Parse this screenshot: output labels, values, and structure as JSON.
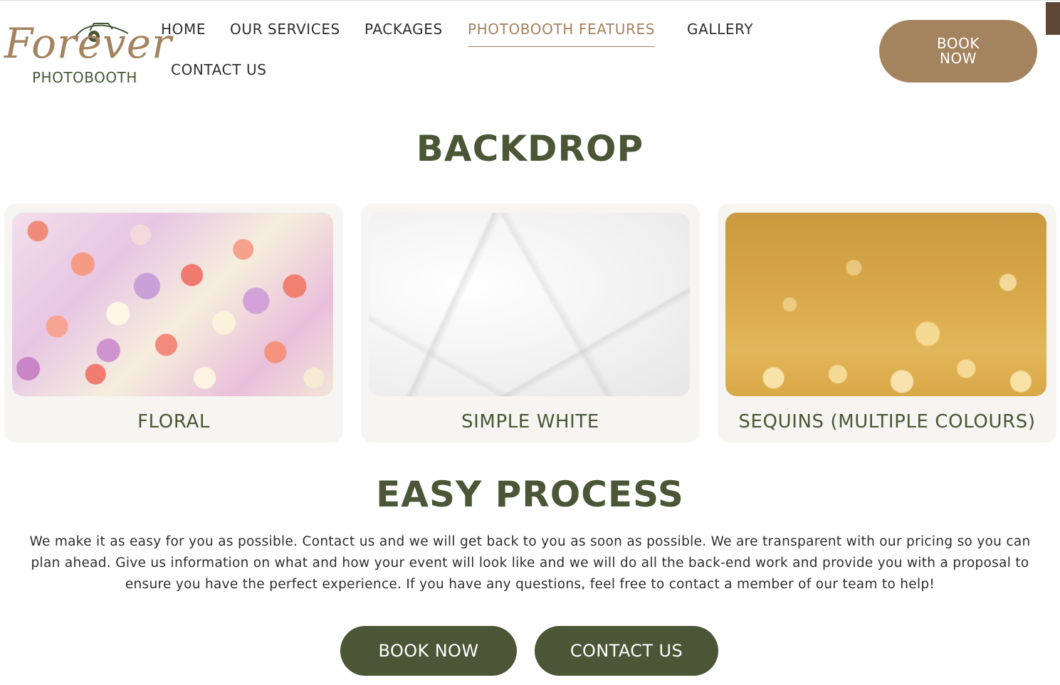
{
  "logo": {
    "script": "Forever",
    "sub": "PHOTOBOOTH"
  },
  "nav": {
    "items": [
      "HOME",
      "OUR SERVICES",
      "PACKAGES",
      "PHOTOBOOTH FEATURES",
      "GALLERY",
      "CONTACT US"
    ],
    "active": "PHOTOBOOTH FEATURES"
  },
  "header_cta": {
    "line1": "BOOK",
    "line2": "NOW"
  },
  "backdrop": {
    "title": "BACKDROP",
    "cards": [
      {
        "label": "FLORAL"
      },
      {
        "label": "SIMPLE WHITE"
      },
      {
        "label": "SEQUINS (MULTIPLE COLOURS)"
      }
    ]
  },
  "process": {
    "title": "EASY PROCESS",
    "text": "We make it as easy for you as possible. Contact us and we will get back to you as soon as possible. We are transparent with our pricing so you can plan ahead. Give us information on what and how your event will look like and we will do all the back-end work and provide you with a proposal to ensure you have the perfect experience. If you have any questions, feel free to contact a member of our team to help!",
    "book_label": "BOOK NOW",
    "contact_label": "CONTACT US"
  },
  "colors": {
    "accent": "#a4835f",
    "primary": "#4a5636",
    "text": "#2e2e2e"
  }
}
